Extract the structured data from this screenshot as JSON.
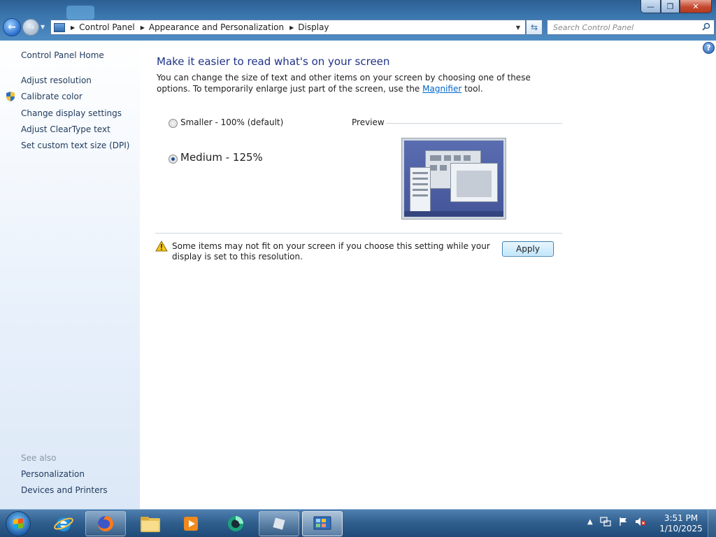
{
  "window": {
    "controls": {
      "minimize": "—",
      "maximize": "❐",
      "close": "✕"
    }
  },
  "nav": {
    "back_icon": "←",
    "forward_icon": "→"
  },
  "address": {
    "crumbs": [
      "Control Panel",
      "Appearance and Personalization",
      "Display"
    ],
    "refresh_icon": "⇆"
  },
  "search": {
    "placeholder": "Search Control Panel"
  },
  "sidebar": {
    "home": "Control Panel Home",
    "items": [
      "Adjust resolution",
      "Calibrate color",
      "Change display settings",
      "Adjust ClearType text",
      "Set custom text size (DPI)"
    ],
    "see_also_label": "See also",
    "see_also": [
      "Personalization",
      "Devices and Printers"
    ]
  },
  "main": {
    "title": "Make it easier to read what's on your screen",
    "description_before": "You can change the size of text and other items on your screen by choosing one of these options. To temporarily enlarge just part of the screen, use the ",
    "description_link": "Magnifier",
    "description_after": " tool.",
    "options": [
      {
        "label": "Smaller - 100% (default)",
        "selected": false
      },
      {
        "label": "Medium - 125%",
        "selected": true
      }
    ],
    "preview_label": "Preview",
    "warning": "Some items may not fit on your screen if you choose this setting while your display is set to this resolution.",
    "apply_label": "Apply"
  },
  "taskbar": {
    "pinned": [
      "internet-explorer-icon",
      "firefox-icon",
      "file-explorer-icon",
      "media-player-icon",
      "app-icon",
      "blank-app-icon",
      "control-panel-icon"
    ],
    "clock_time": "3:51 PM",
    "clock_date": "1/10/2025"
  },
  "colors": {
    "title_blue": "#1e3287",
    "link_blue": "#0066cc",
    "sidebar_link": "#1e395b",
    "muted": "#8a98a8"
  }
}
